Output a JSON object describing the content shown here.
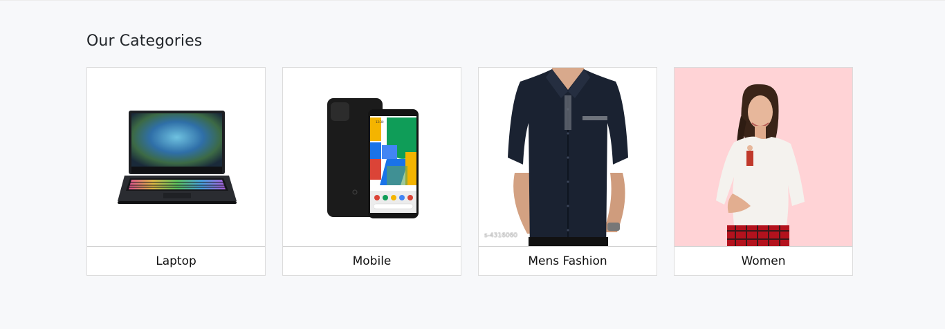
{
  "section": {
    "title": "Our Categories"
  },
  "categories": [
    {
      "label": "Laptop",
      "image": "laptop-image"
    },
    {
      "label": "Mobile",
      "image": "smartphone-image"
    },
    {
      "label": "Mens Fashion",
      "image": "mens-shirt-image",
      "watermark": "s-4316060"
    },
    {
      "label": "Women",
      "image": "womens-top-image"
    }
  ],
  "colors": {
    "page_background": "#f7f8fa",
    "card_background": "#ffffff",
    "women_card_background": "#ffd3d6"
  }
}
